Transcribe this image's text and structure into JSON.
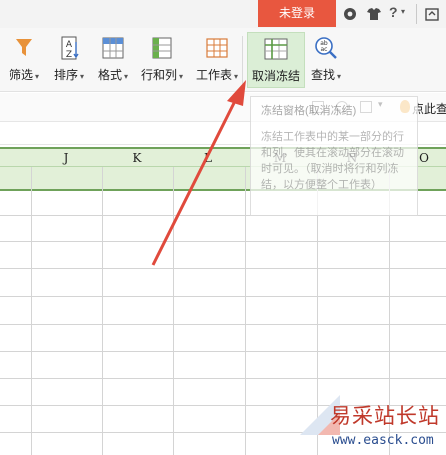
{
  "topbar": {
    "login_label": "未登录",
    "help_label": "?",
    "icons": [
      "settings-icon",
      "shirt-icon",
      "help-icon",
      "window-icon"
    ]
  },
  "ribbon": {
    "buttons": [
      {
        "label": "筛选",
        "has_caret": true,
        "icon": "funnel-icon"
      },
      {
        "label": "排序",
        "has_caret": true,
        "icon": "sort-az-icon"
      },
      {
        "label": "格式",
        "has_caret": true,
        "icon": "format-grid-icon"
      },
      {
        "label": "行和列",
        "has_caret": true,
        "icon": "rows-cols-icon"
      },
      {
        "label": "工作表",
        "has_caret": true,
        "icon": "worksheet-icon"
      },
      {
        "label": "取消冻结",
        "has_caret": false,
        "icon": "unfreeze-icon",
        "active": true
      },
      {
        "label": "查找",
        "has_caret": true,
        "icon": "find-icon"
      }
    ],
    "caret_glyph": "▾"
  },
  "subrow": {
    "click_find_label": "点此查找"
  },
  "tooltip": {
    "title": "冻结窗格(取消冻结)",
    "body": "冻结工作表中的某一部分的行和列，使其在滚动部分在滚动时可见。（取消时将行和列冻结，以方便整个工作表）"
  },
  "sheet": {
    "columns": [
      "J",
      "K",
      "L",
      "M",
      "N",
      "O"
    ]
  },
  "watermark": {
    "chinese": "易采站长站",
    "url": "www.easck.com"
  },
  "colors": {
    "login_bg": "#e8573f",
    "freeze_green": "#6fa25a",
    "frozen_fill": "#e2f0d8",
    "active_button": "#dbeed6",
    "arrow": "#e04a3c",
    "watermark_red": "#c0392b",
    "watermark_blue": "#2a4d8f"
  }
}
